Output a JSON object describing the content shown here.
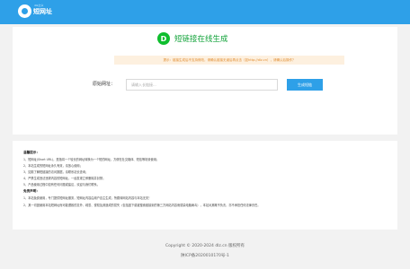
{
  "header": {
    "logo_small": "dlz之众",
    "logo_text": "短网址",
    "accent_color": "#2ea0e8"
  },
  "main": {
    "title_icon": "D",
    "title": "短链接在线生成",
    "tip": "提示：链接生成后不支持修改，请确认链接无误后再点击（如http://dlz.cn），请确认后操作？",
    "url_label": "原始网址：",
    "url_placeholder": "请输入长链接...",
    "url_value": "",
    "generate_button": "生成短链"
  },
  "notice": {
    "heading": "温馨提示：",
    "items": [
      "1、短网址(Short URL)，是指将一个较长的网址转换为一个短的网址，方便在社交媒体、短信等场景使用；",
      "2、本站生成的短网址永久有效，请放心使用；",
      "3、如需了解短链接的访问数据，请联系站长查询；",
      "4、严禁生成违法违规内容的短网址，一经发现立即删除并封禁；",
      "5、产品使用过程中如有任何问题或建议，欢迎与我们联系。"
    ],
    "disclaimer_heading": "免责声明：",
    "disclaimer_items": [
      "1、本站免费使用，专门提供短网址服务，短网址内容由用户自主生成，所跳转网站内容与本站无关！",
      "2、其一切因使用本站短网址而可能遭致的意外、疏忽、侵权及其造成的损失（包括因下载被搜索链接到的第三方网站内容而感染电脑病毒），本站对其概不负责，亦不承担任何法律责任。"
    ]
  },
  "footer": {
    "copyright": "Copyright © 2020-2024 dlz.cn 版权所有",
    "icp": "陕ICP备2020010170号-1"
  }
}
